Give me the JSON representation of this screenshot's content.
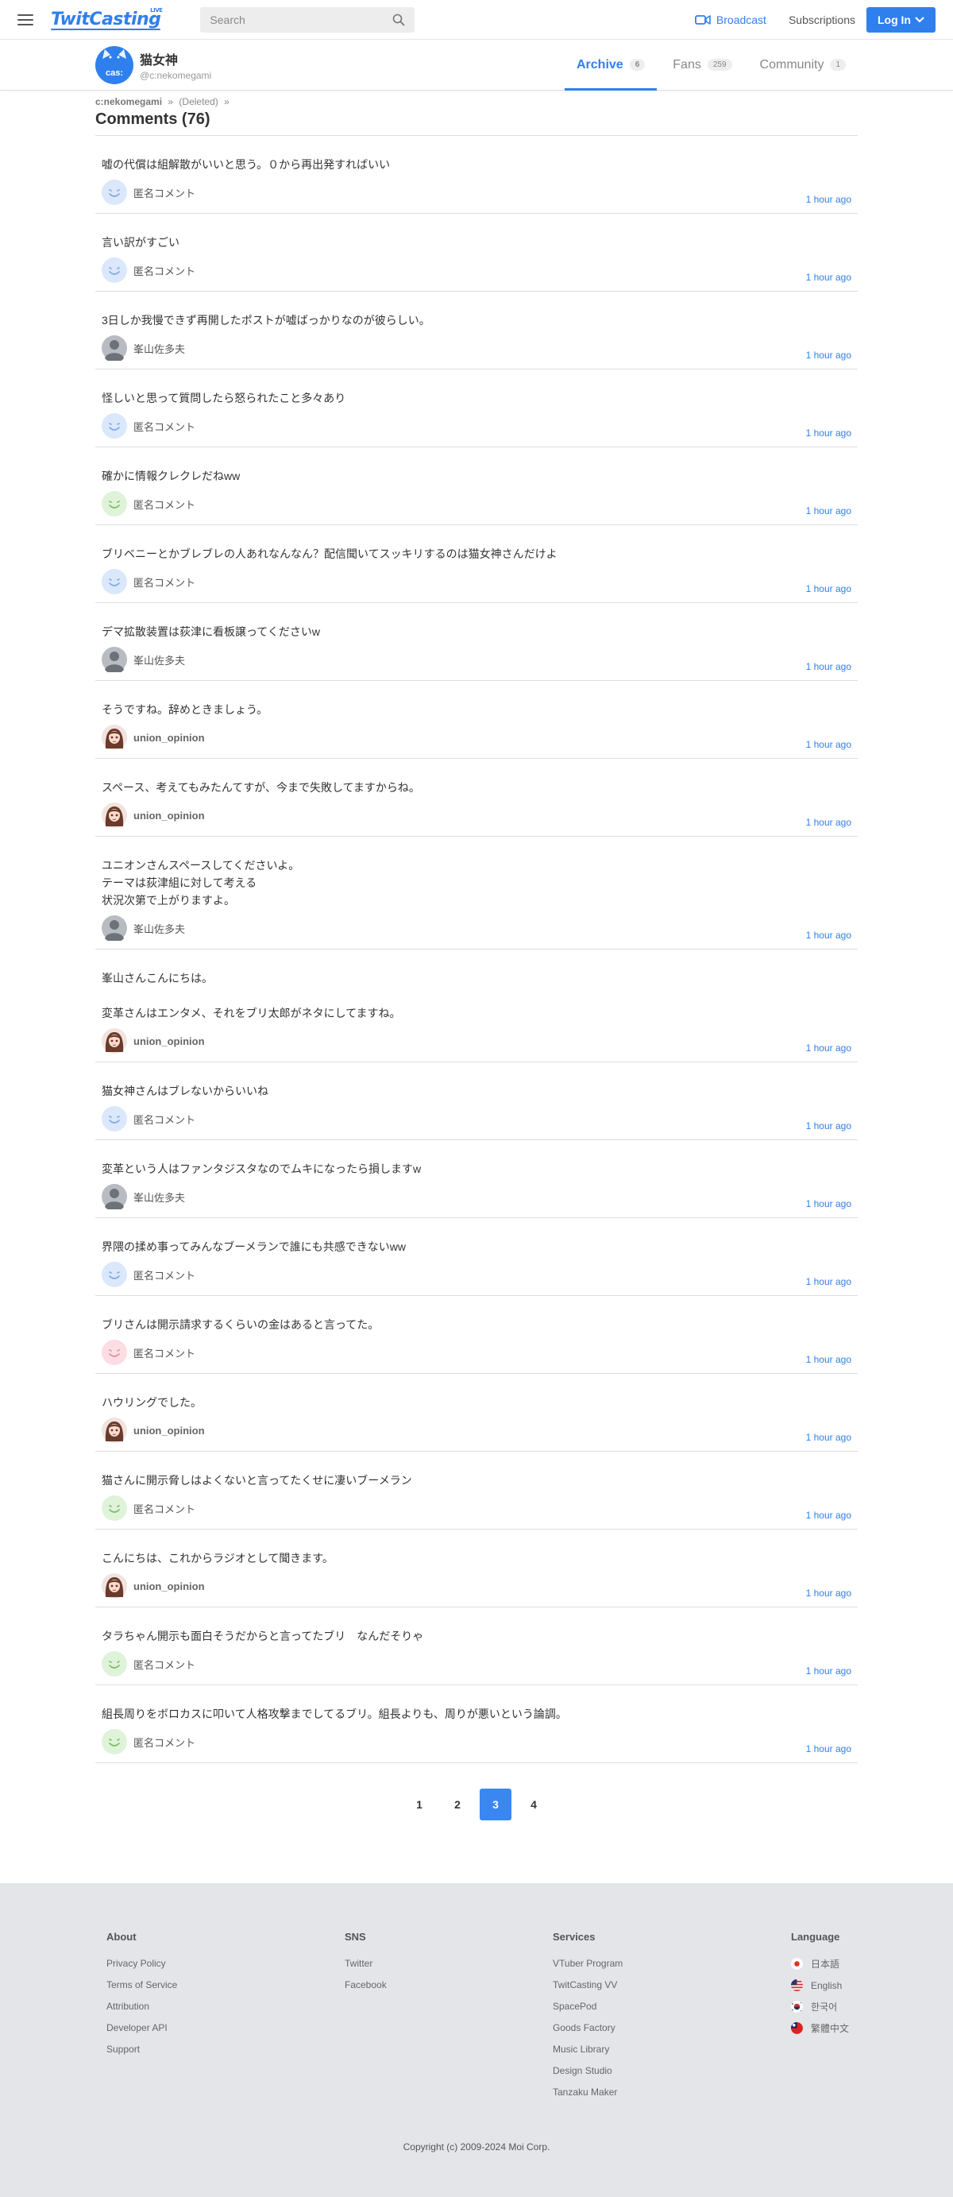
{
  "header": {
    "logo_text": "TwitCasting",
    "logo_badge": "LIVE",
    "search_placeholder": "Search",
    "broadcast_label": "Broadcast",
    "subscriptions_label": "Subscriptions",
    "login_label": "Log In",
    "accent_color": "#2f80ed"
  },
  "profile": {
    "avatar_text": "cas:",
    "name": "猫女神",
    "handle": "@c:nekomegami",
    "tabs": [
      {
        "label": "Archive",
        "count": "6",
        "active": true
      },
      {
        "label": "Fans",
        "count": "259",
        "active": false
      },
      {
        "label": "Community",
        "count": "1",
        "active": false
      }
    ]
  },
  "breadcrumb": {
    "item1": "c:nekomegami",
    "item2": "(Deleted)",
    "sep": "»"
  },
  "page_title": "Comments (76)",
  "comments": [
    {
      "text": "嘘の代償は組解散がいいと思う。０から再出発すればいい",
      "user": "匿名コメント",
      "avatar": "anon-blue",
      "time": "1 hour ago"
    },
    {
      "text": "言い訳がすごい",
      "user": "匿名コメント",
      "avatar": "anon-blue",
      "time": "1 hour ago"
    },
    {
      "text": "3日しか我慢できず再開したポストが嘘ばっかりなのが彼らしい。",
      "user": "峯山佐多夫",
      "avatar": "person-gray",
      "time": "1 hour ago"
    },
    {
      "text": "怪しいと思って質問したら怒られたこと多々あり",
      "user": "匿名コメント",
      "avatar": "anon-blue",
      "time": "1 hour ago"
    },
    {
      "text": "確かに情報クレクレだねww",
      "user": "匿名コメント",
      "avatar": "anon-green",
      "time": "1 hour ago"
    },
    {
      "text": "ブリベニーとかブレブレの人あれなんなん？配信聞いてスッキリするのは猫女神さんだけよ",
      "user": "匿名コメント",
      "avatar": "anon-blue",
      "time": "1 hour ago"
    },
    {
      "text": "デマ拡散装置は荻津に看板譲ってくださいw",
      "user": "峯山佐多夫",
      "avatar": "person-gray",
      "time": "1 hour ago"
    },
    {
      "text": "そうですね。辞めときましょう。",
      "user": "union_opinion",
      "avatar": "union",
      "time": "1 hour ago"
    },
    {
      "text": "スペース、考えてもみたんてすが、今まで失敗してますからね。",
      "user": "union_opinion",
      "avatar": "union",
      "time": "1 hour ago"
    },
    {
      "text": "ユニオンさんスペースしてくださいよ。\nテーマは荻津組に対して考える\n状況次第で上がりますよ。",
      "user": "峯山佐多夫",
      "avatar": "person-gray",
      "time": "1 hour ago"
    },
    {
      "text": "峯山さんこんにちは。\n\n変革さんはエンタメ、それをブリ太郎がネタにしてますね。",
      "user": "union_opinion",
      "avatar": "union",
      "time": "1 hour ago"
    },
    {
      "text": "猫女神さんはブレないからいいね",
      "user": "匿名コメント",
      "avatar": "anon-blue",
      "time": "1 hour ago"
    },
    {
      "text": "変革という人はファンタジスタなのでムキになったら損しますw",
      "user": "峯山佐多夫",
      "avatar": "person-gray",
      "time": "1 hour ago"
    },
    {
      "text": "界隈の揉め事ってみんなブーメランで誰にも共感できないww",
      "user": "匿名コメント",
      "avatar": "anon-blue",
      "time": "1 hour ago"
    },
    {
      "text": "ブリさんは開示請求するくらいの金はあると言ってた。",
      "user": "匿名コメント",
      "avatar": "anon-pink",
      "time": "1 hour ago"
    },
    {
      "text": "ハウリングでした。",
      "user": "union_opinion",
      "avatar": "union",
      "time": "1 hour ago"
    },
    {
      "text": "猫さんに開示脅しはよくないと言ってたくせに凄いブーメラン",
      "user": "匿名コメント",
      "avatar": "anon-green",
      "time": "1 hour ago"
    },
    {
      "text": "こんにちは、これからラジオとして聞きます。",
      "user": "union_opinion",
      "avatar": "union",
      "time": "1 hour ago"
    },
    {
      "text": "タラちゃん開示も面白そうだからと言ってたブリ　なんだそりゃ",
      "user": "匿名コメント",
      "avatar": "anon-green",
      "time": "1 hour ago"
    },
    {
      "text": "組長周りをボロカスに叩いて人格攻撃までしてるブリ。組長よりも、周りが悪いという論調。",
      "user": "匿名コメント",
      "avatar": "anon-green",
      "time": "1 hour ago"
    }
  ],
  "pagination": {
    "pages": [
      "1",
      "2",
      "3",
      "4"
    ],
    "current": "3"
  },
  "footer": {
    "columns": [
      {
        "title": "About",
        "links": [
          "Privacy Policy",
          "Terms of Service",
          "Attribution",
          "Developer API",
          "Support"
        ]
      },
      {
        "title": "SNS",
        "links": [
          "Twitter",
          "Facebook"
        ]
      },
      {
        "title": "Services",
        "links": [
          "VTuber Program",
          "TwitCasting VV",
          "SpacePod",
          "Goods Factory",
          "Music Library",
          "Design Studio",
          "Tanzaku Maker"
        ]
      }
    ],
    "language": {
      "title": "Language",
      "items": [
        {
          "label": "日本語",
          "flag": "jp"
        },
        {
          "label": "English",
          "flag": "us"
        },
        {
          "label": "한국어",
          "flag": "kr"
        },
        {
          "label": "繁體中文",
          "flag": "tw"
        }
      ]
    },
    "copyright": "Copyright (c) 2009-2024 Moi Corp."
  }
}
